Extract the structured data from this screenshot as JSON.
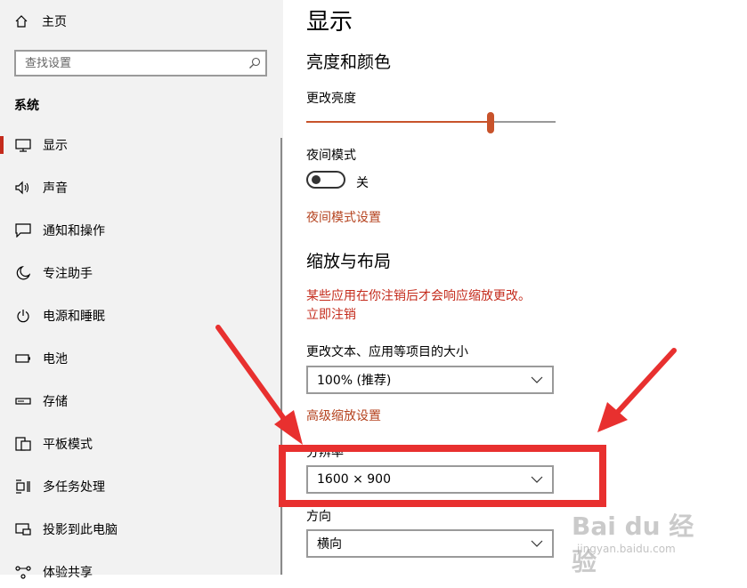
{
  "sidebar": {
    "home_label": "主页",
    "search_placeholder": "查找设置",
    "section_title": "系统",
    "items": [
      {
        "label": "显示",
        "icon": "monitor-icon",
        "active": true
      },
      {
        "label": "声音",
        "icon": "speaker-icon"
      },
      {
        "label": "通知和操作",
        "icon": "message-icon"
      },
      {
        "label": "专注助手",
        "icon": "moon-icon"
      },
      {
        "label": "电源和睡眠",
        "icon": "power-icon"
      },
      {
        "label": "电池",
        "icon": "battery-icon"
      },
      {
        "label": "存储",
        "icon": "storage-icon"
      },
      {
        "label": "平板模式",
        "icon": "tablet-icon"
      },
      {
        "label": "多任务处理",
        "icon": "multitask-icon"
      },
      {
        "label": "投影到此电脑",
        "icon": "project-icon"
      },
      {
        "label": "体验共享",
        "icon": "share-icon"
      }
    ]
  },
  "main": {
    "title": "显示",
    "brightness_heading": "亮度和颜色",
    "brightness_label": "更改亮度",
    "brightness_level": 0.74,
    "night_mode_label": "夜间模式",
    "night_mode_state": "关",
    "night_mode_settings_link": "夜间模式设置",
    "scale_heading": "缩放与布局",
    "warning_line1": "某些应用在你注销后才会响应缩放更改。",
    "warning_link": "立即注销",
    "scale_label": "更改文本、应用等项目的大小",
    "scale_value": "100% (推荐)",
    "advanced_scale_link": "高级缩放设置",
    "resolution_label": "分辨率",
    "resolution_value": "1600 × 900",
    "orientation_label": "方向",
    "orientation_value": "横向"
  },
  "watermark": {
    "logo": "Bai du 经验",
    "url": "jingyan.baidu.com"
  },
  "colors": {
    "accent": "#c8532b",
    "link": "#b5431f",
    "annotation_red": "#e8302f"
  }
}
